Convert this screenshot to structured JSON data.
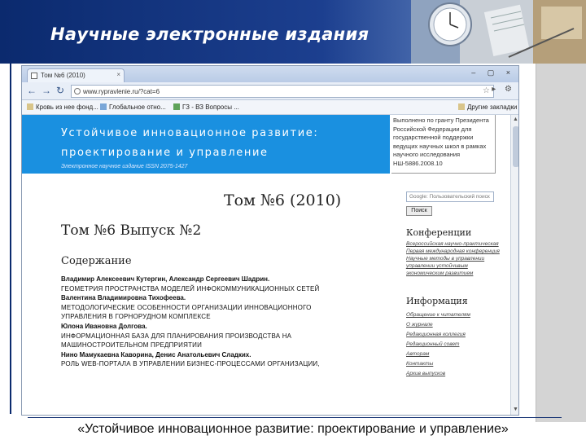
{
  "slide": {
    "title": "Научные электронные издания",
    "caption": "«Устойчивое инновационное развитие: проектирование и управление»"
  },
  "browser": {
    "tab_label": "Том №6 (2010)",
    "tab_close": "×",
    "window_controls": "– ▢ ×",
    "back_icon": "←",
    "forward_icon": "→",
    "reload_icon": "↻",
    "url": "www.rypravlenie.ru/?cat=6",
    "bookmark_star": "☆",
    "toolbar_icons": "▸ ⚙",
    "bookmarks": [
      {
        "label": "Кровь из нее фонд..."
      },
      {
        "label": "Глобальное отно..."
      },
      {
        "label": "ГЗ - ВЗ Вопросы ..."
      }
    ],
    "other_bookmarks": "Другие закладки"
  },
  "page": {
    "journal_line1": "Устойчивое инновационное развитие:",
    "journal_line2": "проектирование и управление",
    "journal_sub": "Электронное научное издание ISSN 2075-1427",
    "grant_text": "Выполнено по гранту Президента Российской Федерации для государственной поддержки ведущих научных школ в рамках научного исследования НШ-5886.2008.10",
    "volume_title": "Том №6 (2010)",
    "issue_title": "Том №6 Выпуск №2",
    "contents_title": "Содержание",
    "articles": [
      {
        "authors": "Владимир Алексеевич Кутергин, Александр Сергеевич Шадрин.",
        "title": "Геометрия пространства моделей инфокоммуникационных сетей"
      },
      {
        "authors": "Валентина Владимировна Тихофеева.",
        "title": "Методологические особенности организации инновационного управления в горнорудном комплексе"
      },
      {
        "authors": "Юлона Ивановна Долгова.",
        "title": "Информационная база для планирования производства на машиностроительном предприятии"
      },
      {
        "authors": "Нино Мамукаевна Каворина, Денис Анатольевич Сладких.",
        "title": "Роль Web-портала в управлении бизнес-процессами организации,"
      }
    ],
    "search_placeholder": "Google: Пользовательский поиск",
    "search_button": "Поиск",
    "conferences_heading": "Конференции",
    "conferences_links": [
      "Всероссийская научно-практическая",
      "Первая международная конференция",
      "Научные методы в управлении",
      "управлении устойчивым",
      "экономическим развитием"
    ],
    "info_heading": "Информация",
    "info_links": [
      "Обращение к читателям",
      "О журнале",
      "Редакционная коллегия",
      "Редакционный совет",
      "Авторам",
      "Контакты",
      "Архив выпусков"
    ]
  },
  "colors": {
    "header_blue": "#0b2a6e",
    "banner_blue": "#1a90e0"
  }
}
